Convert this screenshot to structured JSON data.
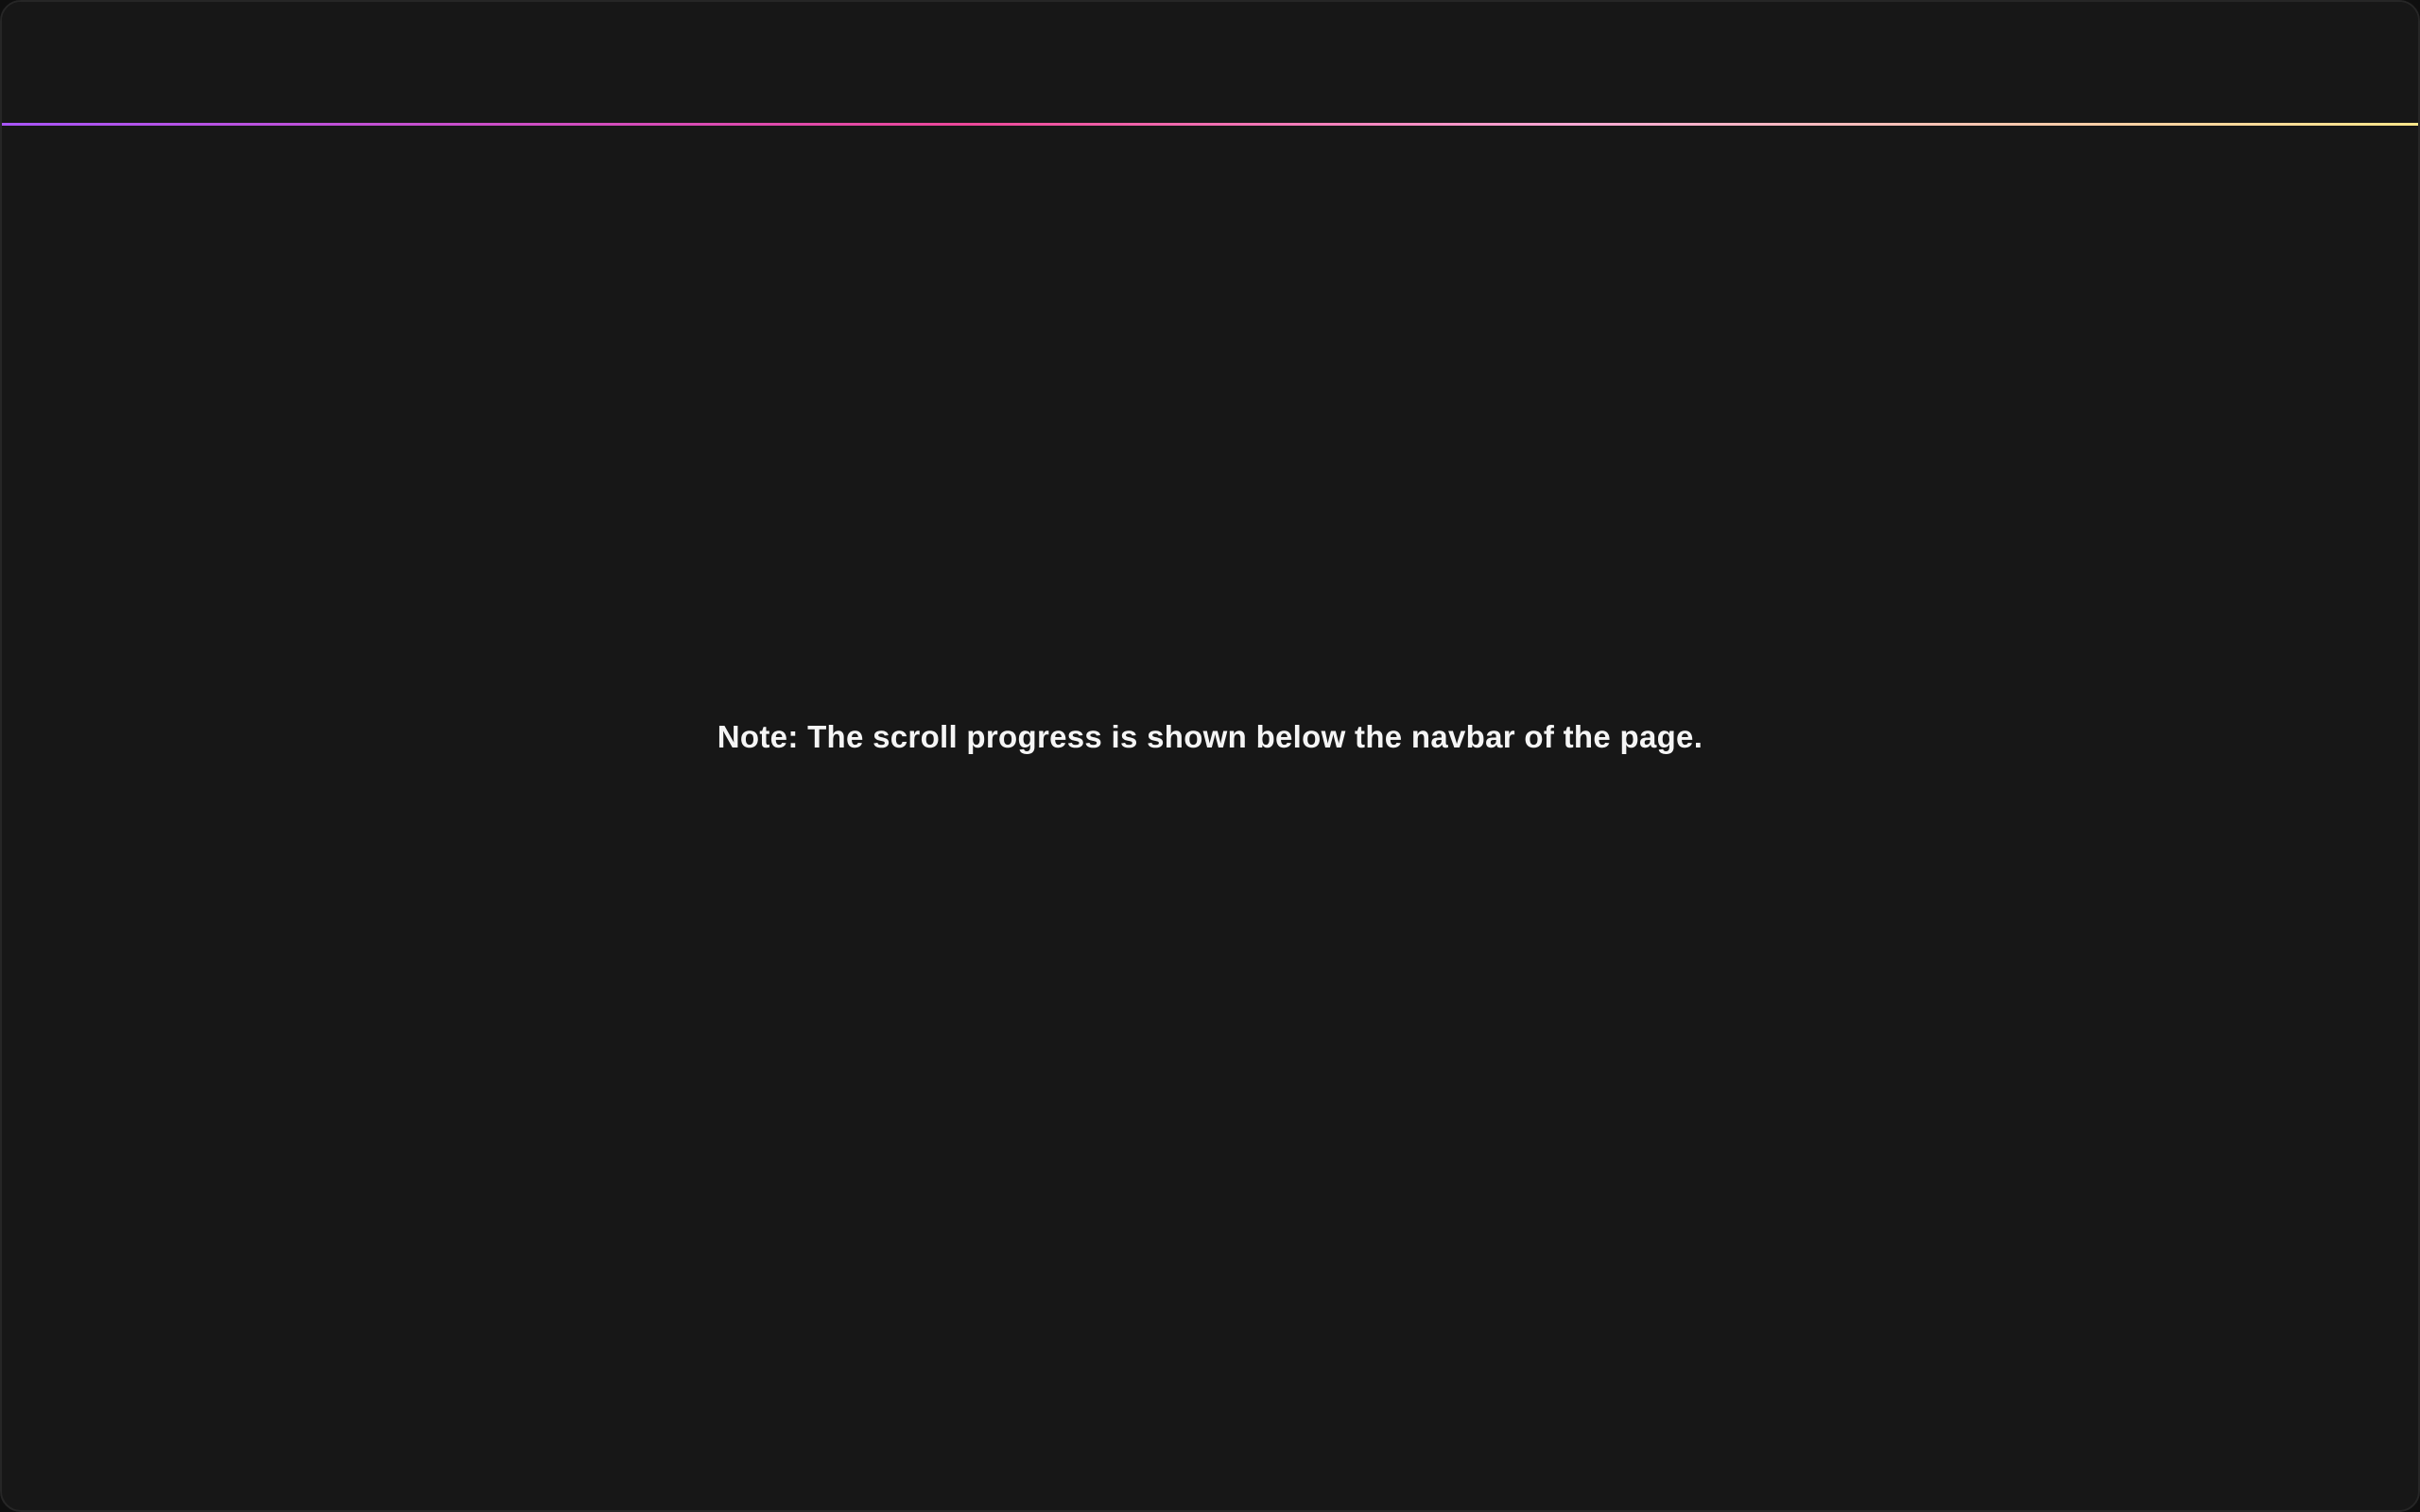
{
  "note": {
    "text": "Note: The scroll progress is shown below the navbar of the page."
  },
  "scroll_progress": {
    "value_fraction": 1.0,
    "gradient_colors": [
      "#a855f7",
      "#ec4899",
      "#f9a8d4",
      "#fde68a"
    ]
  },
  "theme": {
    "background": "#171717",
    "text": "#f5f5f5"
  }
}
